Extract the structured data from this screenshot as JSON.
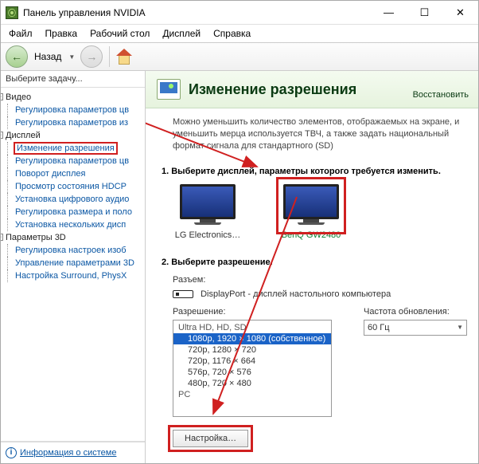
{
  "window": {
    "title": "Панель управления NVIDIA"
  },
  "menu": {
    "file": "Файл",
    "edit": "Правка",
    "desktop": "Рабочий стол",
    "display": "Дисплей",
    "help": "Справка"
  },
  "nav": {
    "back": "Назад"
  },
  "sidebar": {
    "header": "Выберите задачу...",
    "video": {
      "label": "Видео",
      "items": [
        "Регулировка параметров цв",
        "Регулировка параметров из"
      ]
    },
    "display": {
      "label": "Дисплей",
      "items": [
        "Изменение разрешения",
        "Регулировка параметров цв",
        "Поворот дисплея",
        "Просмотр состояния HDCP",
        "Установка цифрового аудио",
        "Регулировка размера и поло",
        "Установка нескольких дисп"
      ]
    },
    "params3d": {
      "label": "Параметры 3D",
      "items": [
        "Регулировка настроек изоб",
        "Управление параметрами 3D",
        "Настройка Surround, PhysX"
      ]
    },
    "sysinfo": "Информация о системе"
  },
  "content": {
    "title": "Изменение разрешения",
    "restore": "Восстановить",
    "desc": "Можно уменьшить количество элементов, отображаемых на экране, и уменьшить мерца используется ТВЧ, а также задать национальный формат сигнала для стандартного (SD)",
    "step1": "1. Выберите дисплей, параметры которого требуется изменить.",
    "monitors": [
      {
        "label": "LG Electronics…",
        "selected": false
      },
      {
        "label": "BenQ GW2480",
        "selected": true
      }
    ],
    "step2": "2. Выберите разрешение.",
    "connector_label": "Разъем:",
    "connector_value": "DisplayPort - дисплей настольного компьютера",
    "resolution_label": "Разрешение:",
    "refresh_label": "Частота обновления:",
    "refresh_value": "60 Гц",
    "res_group1": "Ultra HD, HD, SD",
    "resolutions": [
      "1080p, 1920 × 1080 (собственное)",
      "720p, 1280 × 720",
      "720p, 1176 × 664",
      "576p, 720 × 576",
      "480p, 720 × 480"
    ],
    "res_group2": "PC",
    "customize_btn": "Настройка…"
  }
}
